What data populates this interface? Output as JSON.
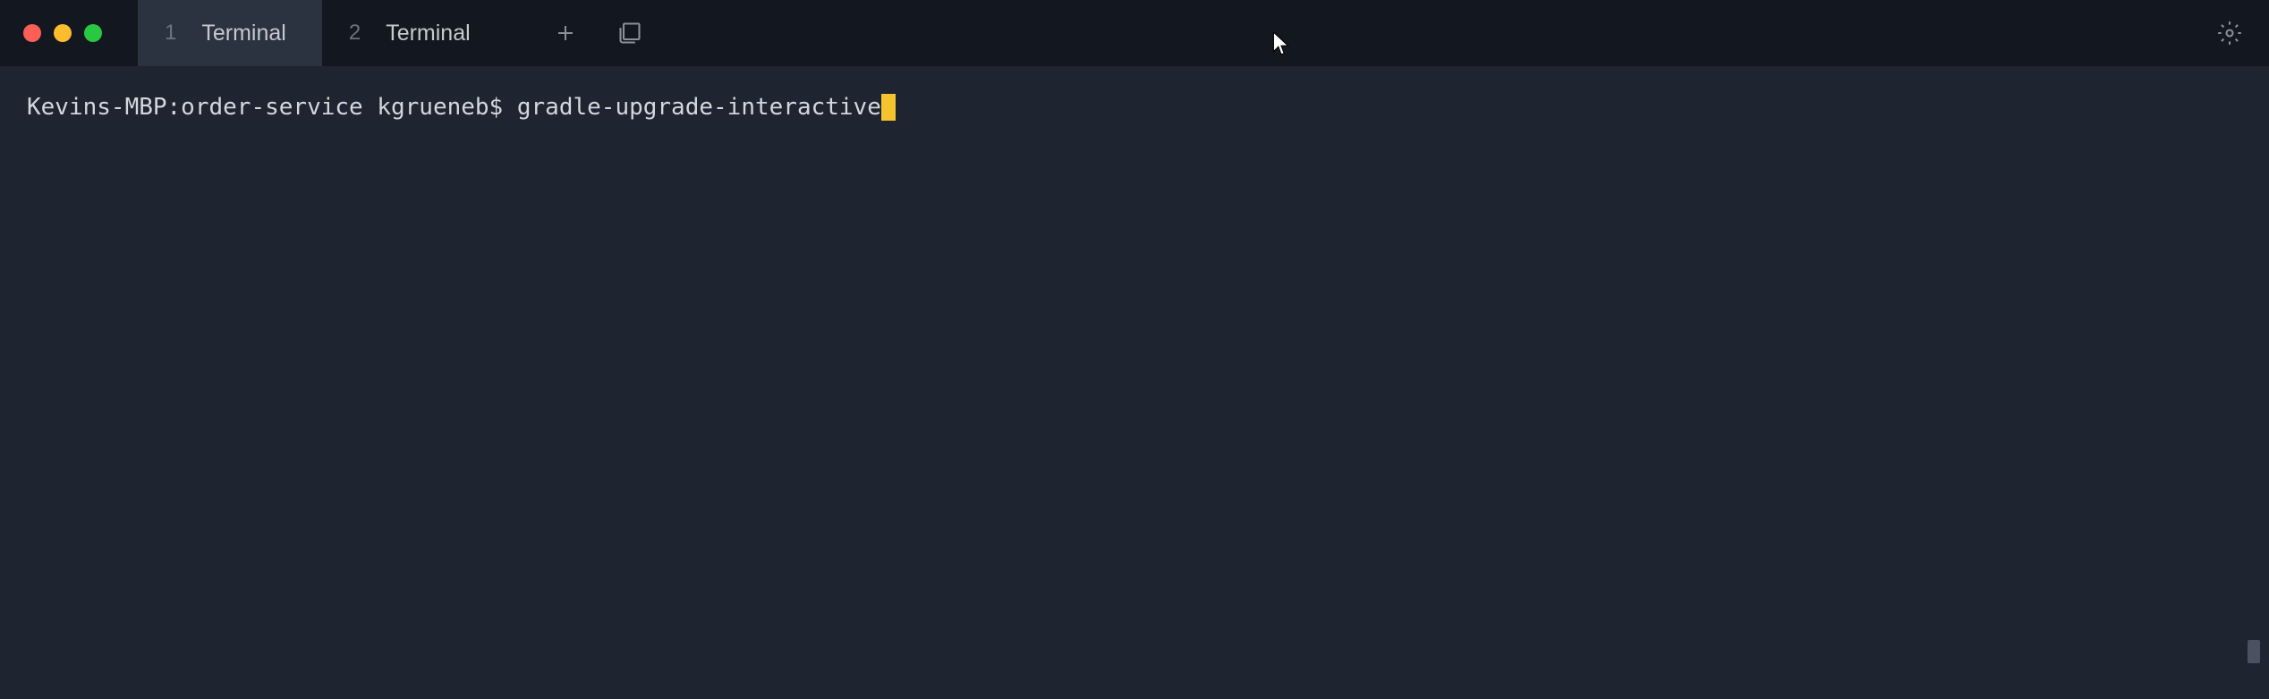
{
  "tabs": [
    {
      "number": "1",
      "label": "Terminal",
      "active": true
    },
    {
      "number": "2",
      "label": "Terminal",
      "active": false
    }
  ],
  "terminal": {
    "prompt": "Kevins-MBP:order-service kgrueneb$ ",
    "command": "gradle-upgrade-interactive"
  }
}
